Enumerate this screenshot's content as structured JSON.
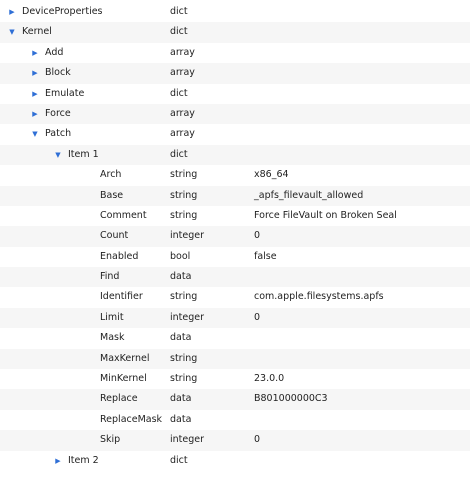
{
  "rows": [
    {
      "key": "DeviceProperties",
      "type": "dict",
      "value": "",
      "expanded": false
    },
    {
      "key": "Kernel",
      "type": "dict",
      "value": "",
      "expanded": true
    },
    {
      "key": "Add",
      "type": "array",
      "value": "",
      "expanded": false
    },
    {
      "key": "Block",
      "type": "array",
      "value": "",
      "expanded": false
    },
    {
      "key": "Emulate",
      "type": "dict",
      "value": "",
      "expanded": false
    },
    {
      "key": "Force",
      "type": "array",
      "value": "",
      "expanded": false
    },
    {
      "key": "Patch",
      "type": "array",
      "value": "",
      "expanded": true
    },
    {
      "key": "Item 1",
      "type": "dict",
      "value": "",
      "expanded": true
    },
    {
      "key": "Arch",
      "type": "string",
      "value": "x86_64"
    },
    {
      "key": "Base",
      "type": "string",
      "value": "_apfs_filevault_allowed"
    },
    {
      "key": "Comment",
      "type": "string",
      "value": "Force FileVault on Broken Seal"
    },
    {
      "key": "Count",
      "type": "integer",
      "value": "0"
    },
    {
      "key": "Enabled",
      "type": "bool",
      "value": "false"
    },
    {
      "key": "Find",
      "type": "data",
      "value": ""
    },
    {
      "key": "Identifier",
      "type": "string",
      "value": "com.apple.filesystems.apfs"
    },
    {
      "key": "Limit",
      "type": "integer",
      "value": "0"
    },
    {
      "key": "Mask",
      "type": "data",
      "value": ""
    },
    {
      "key": "MaxKernel",
      "type": "string",
      "value": ""
    },
    {
      "key": "MinKernel",
      "type": "string",
      "value": "23.0.0"
    },
    {
      "key": "Replace",
      "type": "data",
      "value": "B801000000C3"
    },
    {
      "key": "ReplaceMask",
      "type": "data",
      "value": ""
    },
    {
      "key": "Skip",
      "type": "integer",
      "value": "0"
    },
    {
      "key": "Item 2",
      "type": "dict",
      "value": "",
      "expanded": false
    }
  ],
  "icons": {
    "expanded": "triangle-down-icon",
    "collapsed": "triangle-right-icon",
    "color": "#2f6fd6"
  }
}
